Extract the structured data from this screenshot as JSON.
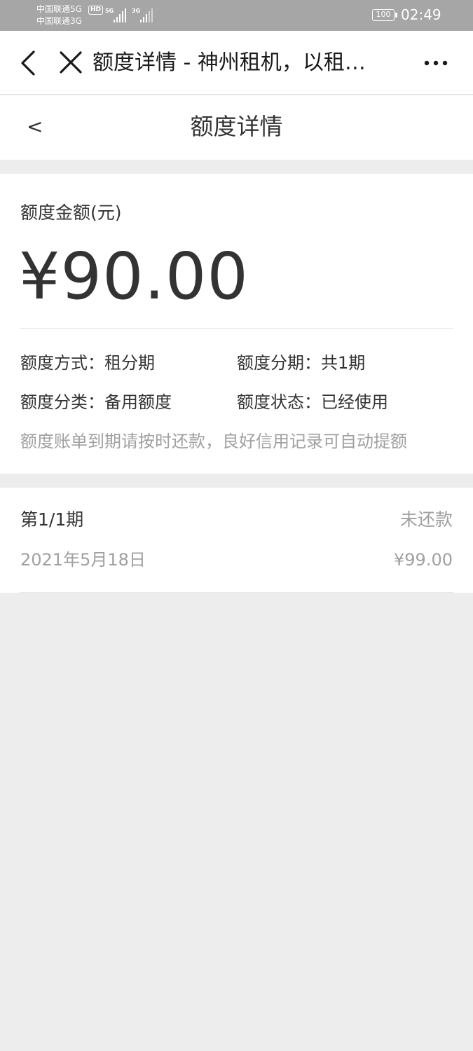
{
  "status_bar": {
    "carrier_1": "中国联通5G",
    "carrier_2": "中国联通3G",
    "hd_badge": "HD",
    "signal_1_label": "5G",
    "signal_2_label": "3G",
    "battery": "100",
    "time": "02:49"
  },
  "wechat_header": {
    "title": "额度详情 - 神州租机，以租…",
    "back_icon": "chevron-left-icon",
    "close_icon": "close-icon",
    "more_icon": "more-horizontal-icon"
  },
  "page_header": {
    "back_label": "<",
    "title": "额度详情"
  },
  "quota": {
    "amount_label": "额度金额(元)",
    "amount": "¥90.00",
    "mode": "额度方式：租分期",
    "installments": "额度分期：共1期",
    "category": "额度分类：备用额度",
    "status": "额度状态：已经使用",
    "note": "额度账单到期请按时还款，良好信用记录可自动提额"
  },
  "installment": {
    "period": "第1/1期",
    "status": "未还款",
    "date": "2021年5月18日",
    "amount": "¥99.00"
  },
  "colors": {
    "status_bar_bg": "#a6a6a6",
    "page_bg": "#ededed",
    "card_bg": "#ffffff",
    "primary_text": "#333333",
    "secondary_text": "#a0a0a0"
  }
}
